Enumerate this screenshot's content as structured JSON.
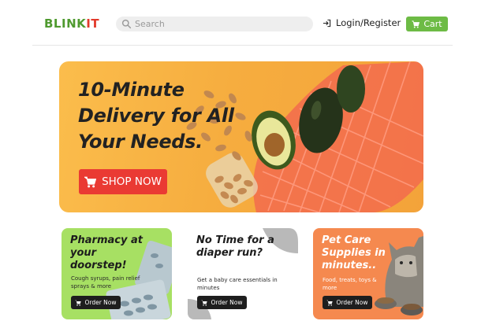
{
  "brand": {
    "logo_part1": "BLINK",
    "logo_part2": "IT",
    "color_green": "#4f9a2f",
    "color_red": "#e23a2b"
  },
  "search": {
    "placeholder": "Search",
    "value": "",
    "icon": "search-icon"
  },
  "nav": {
    "login_label": "Login/Register",
    "login_icon": "login-arrow-icon",
    "cart_label": "Cart",
    "cart_icon": "cart-icon",
    "cart_color": "#6dbb45"
  },
  "hero": {
    "title_line1": "10-Minute",
    "title_line2": "Delivery for All",
    "title_line3": "Your Needs.",
    "cta_label": "SHOP NOW",
    "cta_icon": "cart-icon",
    "cta_color": "#ea3a33",
    "background_color": "#f6ad3f"
  },
  "cards": [
    {
      "title": "Pharmacy at your doorstep!",
      "description": "Cough syrups, pain relief sprays & more",
      "button_label": "Order Now",
      "background_color": "#a7e063"
    },
    {
      "title": "No Time for a diaper run?",
      "description": "Get a baby care essentials in minutes",
      "button_label": "Order Now",
      "background_color": "#ffffff"
    },
    {
      "title": "Pet Care Supplies in minutes..",
      "description": "Food, treats, toys & more",
      "button_label": "Order Now",
      "background_color": "#f5894f"
    }
  ]
}
